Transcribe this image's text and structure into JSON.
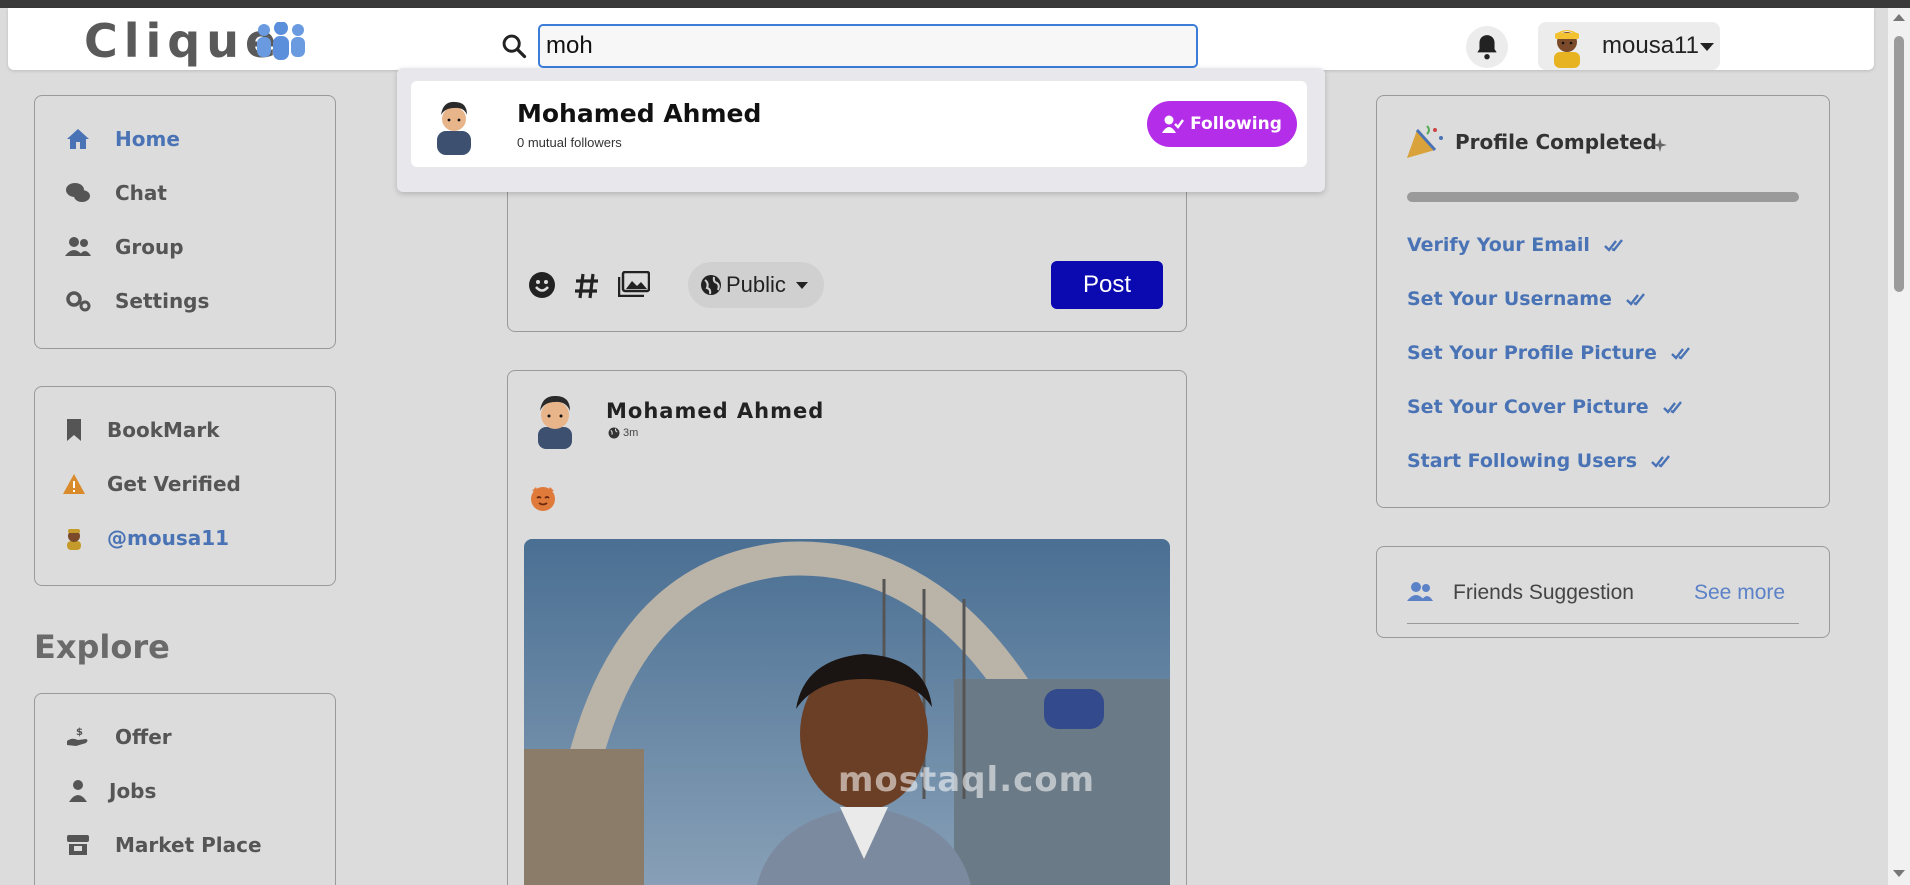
{
  "app": {
    "logo_text": "Clique"
  },
  "search": {
    "value": "moh"
  },
  "header": {
    "username": "mousa11"
  },
  "dropdown": {
    "result_name": "Mohamed Ahmed",
    "result_sub": "0 mutual followers",
    "follow_label": "Following"
  },
  "sidebar": {
    "nav": [
      {
        "label": "Home"
      },
      {
        "label": "Chat"
      },
      {
        "label": "Group"
      },
      {
        "label": "Settings"
      }
    ],
    "secondary": [
      {
        "label": "BookMark"
      },
      {
        "label": "Get Verified"
      },
      {
        "label": "@mousa11"
      }
    ],
    "explore_title": "Explore",
    "explore": [
      {
        "label": "Offer"
      },
      {
        "label": "Jobs"
      },
      {
        "label": "Market Place"
      }
    ]
  },
  "composer": {
    "privacy_label": "Public",
    "post_label": "Post"
  },
  "post": {
    "author": "Mohamed Ahmed",
    "time": "3m"
  },
  "profile_completed": {
    "title": "Profile Completed",
    "tasks": [
      {
        "label": "Verify Your Email"
      },
      {
        "label": "Set Your Username"
      },
      {
        "label": "Set Your Profile Picture"
      },
      {
        "label": "Set Your Cover Picture"
      },
      {
        "label": "Start Following Users"
      }
    ]
  },
  "friends": {
    "title": "Friends Suggestion",
    "see_more": "See more"
  },
  "watermark": "mostaql.com",
  "colors": {
    "accent_blue": "#4a73b5",
    "post_button": "#0a0ab0",
    "following_button": "#b42de8",
    "background": "#dcdcdc"
  }
}
